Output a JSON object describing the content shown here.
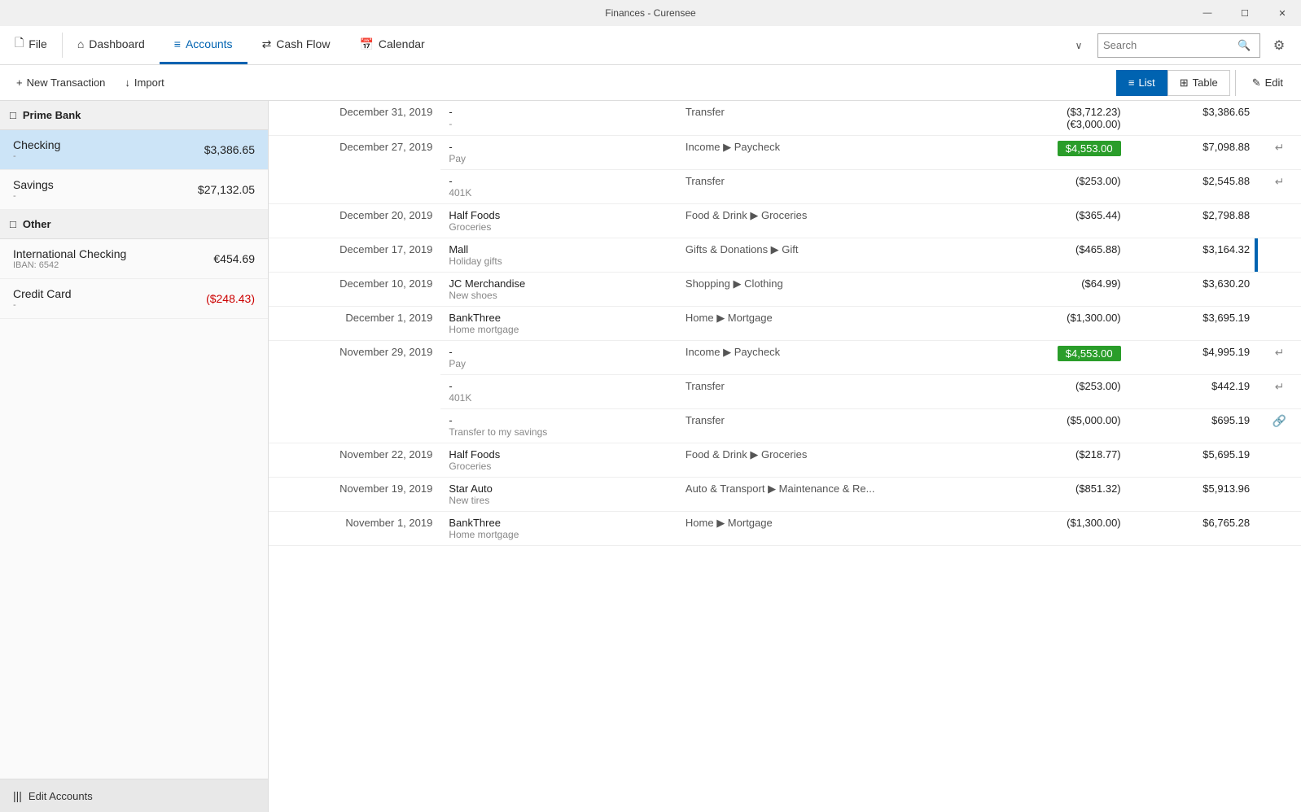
{
  "window": {
    "title": "Finances - Curensee",
    "controls": {
      "minimize": "—",
      "maximize": "☐",
      "close": "✕"
    }
  },
  "menu": {
    "file_label": "File",
    "file_icon": "🗋",
    "dashboard_label": "Dashboard",
    "dashboard_icon": "⌂",
    "accounts_label": "Accounts",
    "accounts_icon": "≡",
    "cashflow_label": "Cash Flow",
    "cashflow_icon": "⇄",
    "calendar_label": "Calendar",
    "calendar_icon": "☰",
    "chevron": "∨",
    "search_placeholder": "Search",
    "search_icon": "🔍",
    "gear_icon": "⚙"
  },
  "toolbar": {
    "new_transaction_label": "New Transaction",
    "new_transaction_icon": "+",
    "import_label": "Import",
    "import_icon": "↓",
    "list_label": "List",
    "list_icon": "≡",
    "table_label": "Table",
    "table_icon": "⊞",
    "edit_label": "Edit",
    "edit_icon": "✎"
  },
  "sidebar": {
    "prime_bank_label": "Prime Bank",
    "prime_bank_icon": "□",
    "other_label": "Other",
    "other_icon": "□",
    "accounts": [
      {
        "id": "checking",
        "name": "Checking",
        "sub": "-",
        "balance": "$3,386.65",
        "negative": false,
        "selected": true
      },
      {
        "id": "savings",
        "name": "Savings",
        "sub": "-",
        "balance": "$27,132.05",
        "negative": false,
        "selected": false
      },
      {
        "id": "intl-checking",
        "name": "International Checking",
        "sub": "IBAN: 6542",
        "balance": "€454.69",
        "negative": false,
        "selected": false
      },
      {
        "id": "credit-card",
        "name": "Credit Card",
        "sub": "-",
        "balance": "($248.43)",
        "negative": true,
        "selected": false
      }
    ],
    "edit_accounts_label": "Edit Accounts",
    "edit_accounts_icon": "|||"
  },
  "transactions": [
    {
      "date": "December 31, 2019",
      "payee1": "-",
      "note1": "-",
      "category1": "Transfer",
      "amount1": "($3,712.23)",
      "amount1b": "(€3,000.00)",
      "balance1": "$3,386.65",
      "action1": "",
      "rowspan": true
    },
    {
      "date": "December 27, 2019",
      "payee1": "-",
      "note1": "Pay",
      "category1": "Income ▶ Paycheck",
      "amount1": "$4,553.00",
      "amount1_income": true,
      "balance1": "$7,098.88",
      "action1": "↵",
      "payee2": "-",
      "note2": "401K",
      "category2": "Transfer",
      "amount2": "($253.00)",
      "balance2": "$2,545.88",
      "action2": "↵",
      "multirow": true
    },
    {
      "date": "December 20, 2019",
      "payee1": "Half Foods",
      "note1": "Groceries",
      "category1": "Food & Drink ▶ Groceries",
      "amount1": "($365.44)",
      "balance1": "$2,798.88",
      "action1": ""
    },
    {
      "date": "December 17, 2019",
      "payee1": "Mall",
      "note1": "Holiday gifts",
      "category1": "Gifts & Donations ▶ Gift",
      "amount1": "($465.88)",
      "balance1": "$3,164.32",
      "action1": "",
      "scrollbar": true
    },
    {
      "date": "December 10, 2019",
      "payee1": "JC Merchandise",
      "note1": "New shoes",
      "category1": "Shopping ▶ Clothing",
      "amount1": "($64.99)",
      "balance1": "$3,630.20",
      "action1": ""
    },
    {
      "date": "December 1, 2019",
      "payee1": "BankThree",
      "note1": "Home mortgage",
      "category1": "Home ▶ Mortgage",
      "amount1": "($1,300.00)",
      "balance1": "$3,695.19",
      "action1": ""
    },
    {
      "date": "November 29, 2019",
      "payee1": "-",
      "note1": "Pay",
      "category1": "Income ▶ Paycheck",
      "amount1": "$4,553.00",
      "amount1_income": true,
      "balance1": "$4,995.19",
      "action1": "↵",
      "payee2": "-",
      "note2": "401K",
      "category2": "Transfer",
      "amount2": "($253.00)",
      "balance2": "$442.19",
      "action2": "↵",
      "payee3": "-",
      "note3": "Transfer to my savings",
      "category3": "Transfer",
      "amount3": "($5,000.00)",
      "balance3": "$695.19",
      "action3": "linked",
      "multirow": true
    },
    {
      "date": "November 22, 2019",
      "payee1": "Half Foods",
      "note1": "Groceries",
      "category1": "Food & Drink ▶ Groceries",
      "amount1": "($218.77)",
      "balance1": "$5,695.19",
      "action1": ""
    },
    {
      "date": "November 19, 2019",
      "payee1": "Star Auto",
      "note1": "New tires",
      "category1": "Auto & Transport ▶ Maintenance & Re...",
      "amount1": "($851.32)",
      "balance1": "$5,913.96",
      "action1": ""
    },
    {
      "date": "November 1, 2019",
      "payee1": "BankThree",
      "note1": "Home mortgage",
      "category1": "Home ▶ Mortgage",
      "amount1": "($1,300.00)",
      "balance1": "$6,765.28",
      "action1": ""
    }
  ]
}
